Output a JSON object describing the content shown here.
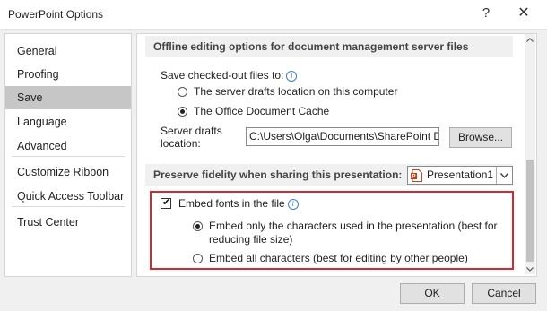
{
  "window": {
    "title": "PowerPoint Options",
    "help_glyph": "?",
    "close_glyph": "✕"
  },
  "sidebar": {
    "items": [
      {
        "label": "General"
      },
      {
        "label": "Proofing"
      },
      {
        "label": "Save",
        "selected": true
      },
      {
        "label": "Language"
      },
      {
        "label": "Advanced"
      },
      {
        "label": "Customize Ribbon"
      },
      {
        "label": "Quick Access Toolbar"
      },
      {
        "label": "Trust Center"
      }
    ]
  },
  "offline": {
    "heading": "Offline editing options for document management server files",
    "save_label": "Save checked-out files to:",
    "option_server": "The server drafts location on this computer",
    "option_cache": "The Office Document Cache",
    "selected_option": "The Office Document Cache",
    "server_drafts_label_line1": "Server drafts",
    "server_drafts_label_line2": "location:",
    "server_drafts_value": "C:\\Users\\Olga\\Documents\\SharePoint Drafts\\",
    "browse_label": "Browse..."
  },
  "fidelity": {
    "heading": "Preserve fidelity when sharing this presentation:",
    "presentation_value": "Presentation1",
    "embed_fonts_label": "Embed fonts in the file",
    "embed_fonts_checked": true,
    "embed_only_line1": "Embed only the characters used in the presentation (best for",
    "embed_only_line2": "reducing file size)",
    "embed_all_label": "Embed all characters (best for editing by other people)",
    "selected_option": "Embed only the characters used in the presentation (best for reducing file size)"
  },
  "buttons": {
    "ok": "OK",
    "cancel": "Cancel"
  },
  "colors": {
    "highlight_border": "#d9272e",
    "selected_nav": "#c6c6c6",
    "powerpoint_icon": "#c43e1c"
  },
  "icons": {
    "info": "info-icon",
    "dropdown": "chevron-down-icon",
    "file": "powerpoint-file-icon"
  }
}
